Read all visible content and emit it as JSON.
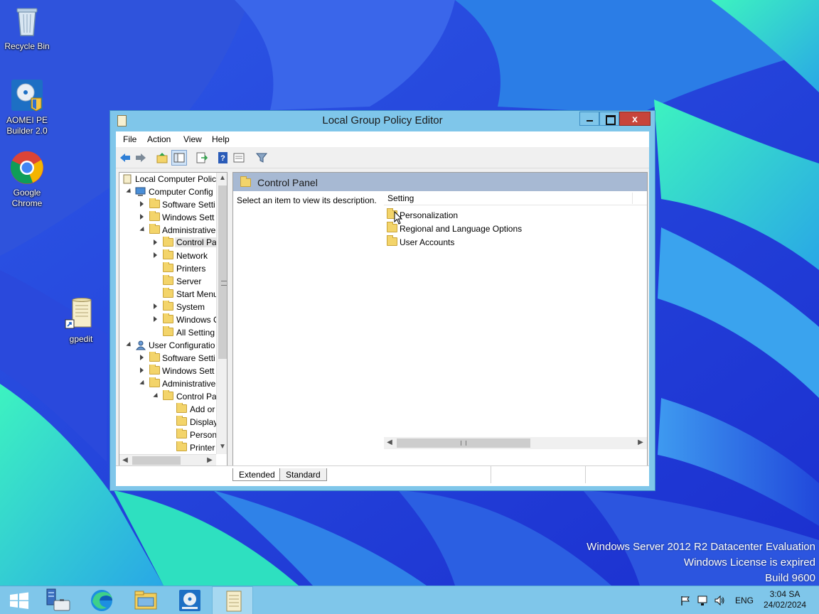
{
  "desktop": {
    "icons": [
      {
        "label": "Recycle Bin"
      },
      {
        "label": "AOMEI PE\nBuilder 2.0"
      },
      {
        "label": "Google\nChrome"
      },
      {
        "label": "gpedit"
      }
    ],
    "watermark": {
      "line1": "Windows Server 2012 R2 Datacenter Evaluation",
      "line2": "Windows License is expired",
      "line3": "Build 9600"
    }
  },
  "window": {
    "title": "Local Group Policy Editor",
    "close_glyph": "x",
    "menu": [
      "File",
      "Action",
      "View",
      "Help"
    ],
    "tree": {
      "rows": [
        "Local Computer Polic",
        "Computer Config",
        "Software Setti",
        "Windows Sett",
        "Administrative",
        "Control Pa",
        "Network",
        "Printers",
        "Server",
        "Start Menu",
        "System",
        "Windows C",
        "All Setting",
        "User Configuratio",
        "Software Setti",
        "Windows Sett",
        "Administrative",
        "Control Pa",
        "Add or",
        "Display",
        "Person",
        "Printer"
      ]
    },
    "right": {
      "header": "Control Panel",
      "description": "Select an item to view its description.",
      "column_setting": "Setting",
      "items": [
        "Personalization",
        "Regional and Language Options",
        "User Accounts"
      ]
    },
    "tabs": {
      "extended": "Extended",
      "standard": "Standard"
    }
  },
  "taskbar": {
    "language": "ENG",
    "time": "3:04 SA",
    "date": "24/02/2024"
  }
}
